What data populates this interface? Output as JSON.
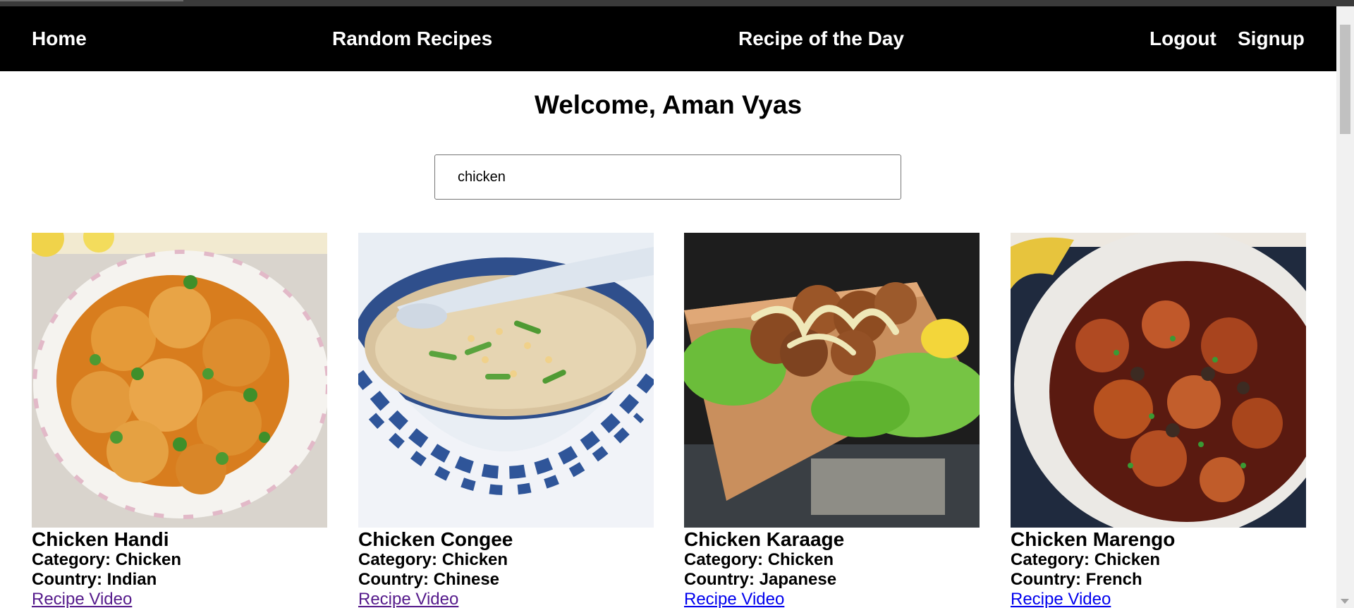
{
  "nav": {
    "home": "Home",
    "random": "Random Recipes",
    "rotd": "Recipe of the Day",
    "logout": "Logout",
    "signup": "Signup"
  },
  "welcome": "Welcome, Aman Vyas",
  "search": {
    "value": "chicken"
  },
  "recipes": [
    {
      "title": "Chicken Handi",
      "category": "Category: Chicken",
      "country": "Country: Indian",
      "video": "Recipe Video"
    },
    {
      "title": "Chicken Congee",
      "category": "Category: Chicken",
      "country": "Country: Chinese",
      "video": "Recipe Video"
    },
    {
      "title": "Chicken Karaage",
      "category": "Category: Chicken",
      "country": "Country: Japanese",
      "video": "Recipe Video"
    },
    {
      "title": "Chicken Marengo",
      "category": "Category: Chicken",
      "country": "Country: French",
      "video": "Recipe Video"
    }
  ],
  "colors": {
    "nav_bg": "#000000",
    "link_visited": "#551a8b",
    "link_unvisited": "#0000ee"
  }
}
